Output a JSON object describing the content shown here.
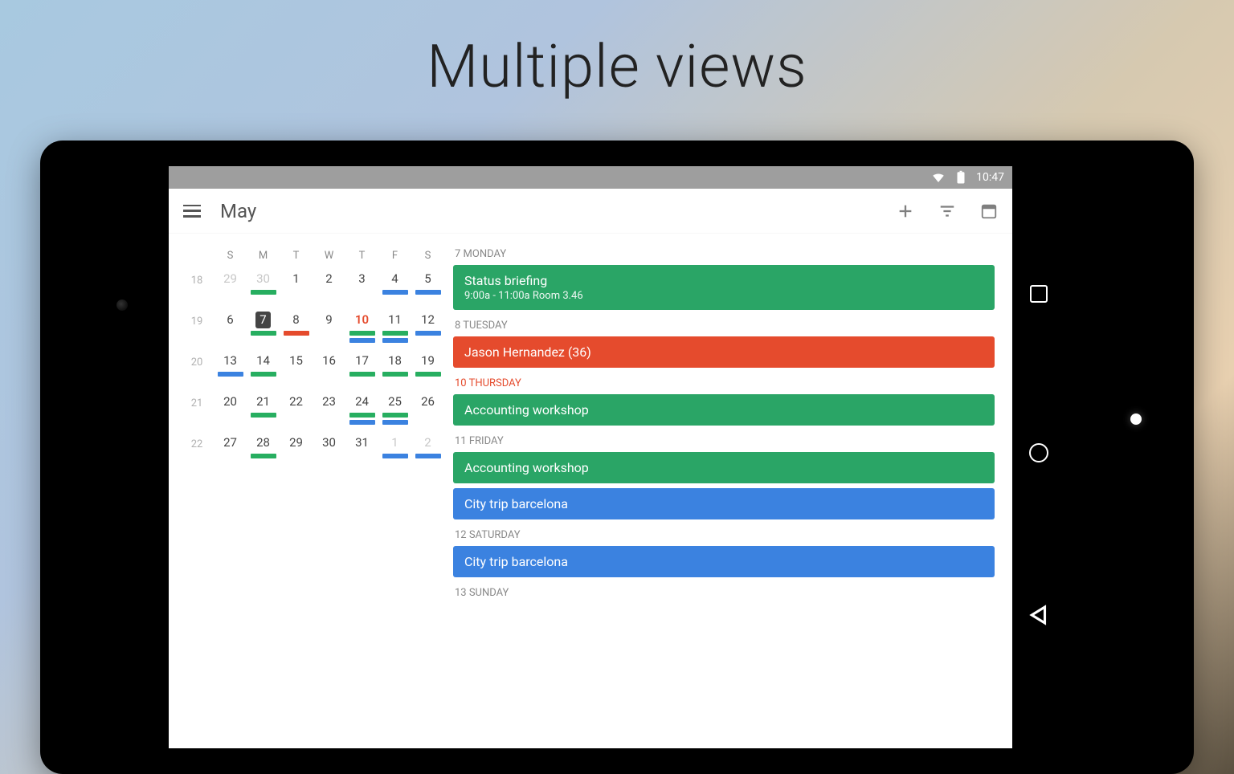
{
  "headline": "Multiple views",
  "status": {
    "time": "10:47"
  },
  "toolbar": {
    "title": "May"
  },
  "colors": {
    "green": "#2aa566",
    "orange": "#e54b2d",
    "blue": "#3b82e0"
  },
  "calendar": {
    "dow": [
      "S",
      "M",
      "T",
      "W",
      "T",
      "F",
      "S"
    ],
    "weeks": [
      {
        "no": "18",
        "days": [
          {
            "n": "29",
            "muted": true
          },
          {
            "n": "30",
            "muted": true,
            "bars": [
              "g"
            ]
          },
          {
            "n": "1"
          },
          {
            "n": "2"
          },
          {
            "n": "3"
          },
          {
            "n": "4",
            "bars": [
              "b"
            ]
          },
          {
            "n": "5",
            "bars": [
              "b"
            ]
          }
        ]
      },
      {
        "no": "19",
        "days": [
          {
            "n": "6"
          },
          {
            "n": "7",
            "selected": true,
            "bars": [
              "g"
            ]
          },
          {
            "n": "8",
            "bars": [
              "o"
            ]
          },
          {
            "n": "9"
          },
          {
            "n": "10",
            "today": true,
            "bars": [
              "g",
              "b"
            ]
          },
          {
            "n": "11",
            "bars": [
              "g",
              "b"
            ]
          },
          {
            "n": "12",
            "bars": [
              "b"
            ]
          }
        ]
      },
      {
        "no": "20",
        "days": [
          {
            "n": "13",
            "bars": [
              "b"
            ]
          },
          {
            "n": "14",
            "bars": [
              "g"
            ]
          },
          {
            "n": "15"
          },
          {
            "n": "16"
          },
          {
            "n": "17",
            "bars": [
              "g"
            ]
          },
          {
            "n": "18",
            "bars": [
              "g"
            ]
          },
          {
            "n": "19",
            "bars": [
              "g"
            ]
          }
        ]
      },
      {
        "no": "21",
        "days": [
          {
            "n": "20"
          },
          {
            "n": "21",
            "bars": [
              "g"
            ]
          },
          {
            "n": "22"
          },
          {
            "n": "23"
          },
          {
            "n": "24",
            "bars": [
              "g",
              "b"
            ]
          },
          {
            "n": "25",
            "bars": [
              "g",
              "b"
            ]
          },
          {
            "n": "26"
          }
        ]
      },
      {
        "no": "22",
        "days": [
          {
            "n": "27"
          },
          {
            "n": "28",
            "bars": [
              "g"
            ]
          },
          {
            "n": "29"
          },
          {
            "n": "30"
          },
          {
            "n": "31"
          },
          {
            "n": "1",
            "muted": true,
            "bars": [
              "b"
            ]
          },
          {
            "n": "2",
            "muted": true,
            "bars": [
              "b"
            ]
          }
        ]
      }
    ]
  },
  "agenda": [
    {
      "header": "7 MONDAY",
      "events": [
        {
          "title": "Status briefing",
          "sub": "9:00a - 11:00a Room 3.46",
          "color": "green"
        }
      ]
    },
    {
      "header": "8 TUESDAY",
      "events": [
        {
          "title": "Jason Hernandez (36)",
          "color": "orange"
        }
      ]
    },
    {
      "header": "10 THURSDAY",
      "today": true,
      "events": [
        {
          "title": "Accounting workshop",
          "color": "green"
        }
      ]
    },
    {
      "header": "11 FRIDAY",
      "events": [
        {
          "title": "Accounting workshop",
          "color": "green"
        },
        {
          "title": "City trip barcelona",
          "color": "blue"
        }
      ]
    },
    {
      "header": "12 SATURDAY",
      "events": [
        {
          "title": "City trip barcelona",
          "color": "blue"
        }
      ]
    },
    {
      "header": "13 SUNDAY",
      "events": []
    }
  ]
}
